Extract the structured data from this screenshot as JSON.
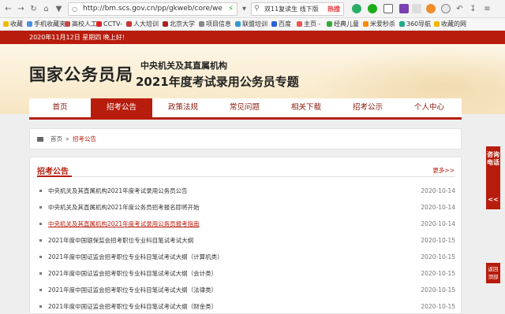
{
  "browser": {
    "url": "http://bm.scs.gov.cn/pp/gkweb/core/we",
    "search_text": "双11复读生 线下版",
    "search_badge": "热搜",
    "bookmarks": [
      "收藏",
      "手机收藏夹",
      "高校人工",
      "CCTV-",
      "人大培训",
      "北京大学",
      "项目信息",
      "联盟培训",
      "百度",
      "主页 -",
      "经典儿童",
      "米爱秒杀",
      "360导航",
      "收藏的网"
    ],
    "colors": {
      "accent": "#b81c0c"
    }
  },
  "site": {
    "date_line": "2020年11月12日  星期四  晚上好!",
    "logo": "国家公务员局",
    "subtitle1": "中央机关及其直属机构",
    "subtitle2": "2021年度考试录用公务员专题",
    "nav": [
      "首页",
      "招考公告",
      "政策法规",
      "常见问题",
      "相关下载",
      "招考公示",
      "个人中心"
    ],
    "breadcrumb": {
      "home": "首页",
      "sep": "»",
      "current": "招考公告"
    },
    "section_title": "招考公告",
    "more": "更多>>",
    "items": [
      {
        "title": "中央机关及其直属机构2021年度考试录用公务员公告",
        "date": "2020-10-14"
      },
      {
        "title": "中央机关及其直属机构2021年度公务员招考报名即将开始",
        "date": "2020-10-14"
      },
      {
        "title": "中央机关及其直属机构2021年度考试录用公务员报考指南",
        "date": "2020-10-14"
      },
      {
        "title": "2021年度中国银保监会招考职位专业科目笔试考试大纲",
        "date": "2020-10-15"
      },
      {
        "title": "2021年度中国证监会招考职位专业科目笔试考试大纲（计算机类）",
        "date": "2020-10-15"
      },
      {
        "title": "2021年度中国证监会招考职位专业科目笔试考试大纲（会计类）",
        "date": "2020-10-15"
      },
      {
        "title": "2021年度中国证监会招考职位专业科目笔试考试大纲（法律类）",
        "date": "2020-10-15"
      },
      {
        "title": "2021年度中国证监会招考职位专业科目笔试考试大纲（财金类）",
        "date": "2020-10-15"
      }
    ],
    "side_float": {
      "label": "咨询电话",
      "arrow": "<<"
    },
    "back_top": "返回顶部"
  }
}
